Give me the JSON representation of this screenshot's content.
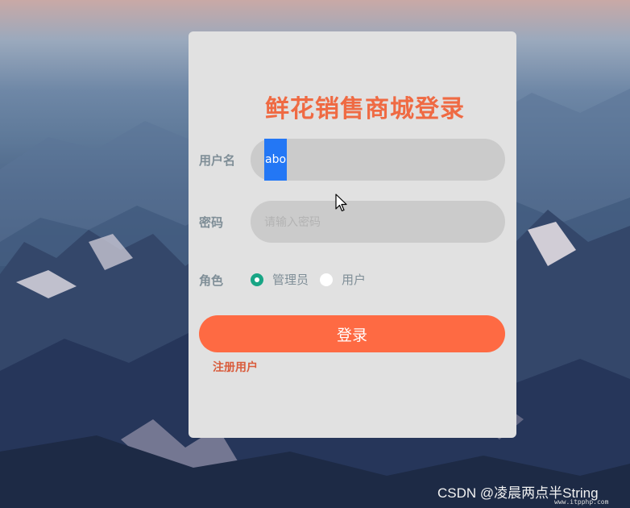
{
  "page": {
    "title": "鲜花销售商城登录"
  },
  "form": {
    "username": {
      "label": "用户名",
      "value": "abo"
    },
    "password": {
      "label": "密码",
      "placeholder": "请输入密码"
    },
    "role": {
      "label": "角色",
      "options": [
        {
          "label": "管理员",
          "selected": true
        },
        {
          "label": "用户",
          "selected": false
        }
      ]
    },
    "login_label": "登录",
    "register_label": "注册用户"
  },
  "watermark": {
    "text": "CSDN @凌晨两点半String",
    "site": "www.itpphp.com"
  },
  "colors": {
    "title": "#ef6a43",
    "login_button": "#fe6a43",
    "radio_selected": "#18a585",
    "selection": "#2377f5"
  },
  "icons": {
    "cursor": "mouse-pointer-icon"
  }
}
